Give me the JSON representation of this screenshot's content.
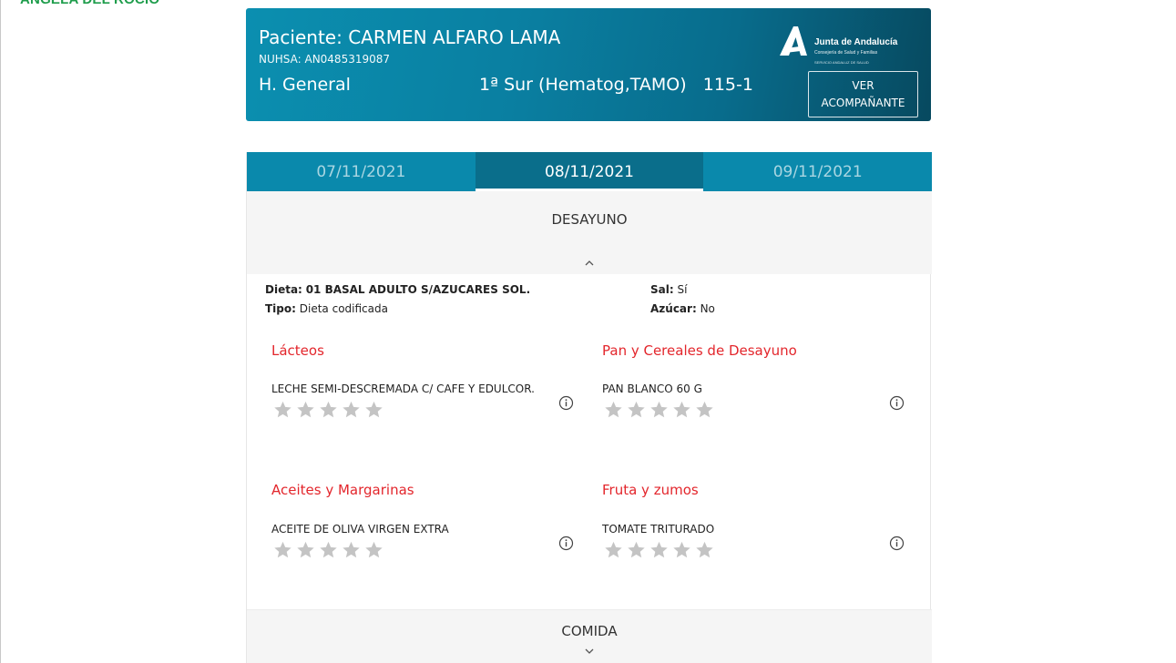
{
  "user": {
    "name": "ANGELA DEL ROCIO"
  },
  "header": {
    "patient_label": "Paciente: CARMEN ALFARO LAMA",
    "nuhsa": "NUHSA: AN0485319087",
    "hospital": "H. General",
    "ward": "1ª Sur (Hematog,TAMO)   115-1",
    "logo": {
      "title": "Junta de Andalucía",
      "subtitle": "Consejería de Salud y Familias",
      "subtitle2": "SERVICIO ANDALUZ DE SALUD"
    },
    "companion_button": {
      "line1": "VER",
      "line2": "ACOMPAÑANTE"
    }
  },
  "tabs": [
    {
      "label": "07/11/2021",
      "active": false
    },
    {
      "label": "08/11/2021",
      "active": true
    },
    {
      "label": "09/11/2021",
      "active": false
    }
  ],
  "meal": {
    "title": "DESAYUNO",
    "diet": {
      "dieta_label": "Dieta:",
      "dieta_value": "01 BASAL ADULTO S/AZUCARES SOL.",
      "tipo_label": "Tipo:",
      "tipo_value": "Dieta codificada",
      "sal_label": "Sal:",
      "sal_value": "Sí",
      "azucar_label": "Azúcar:",
      "azucar_value": "No"
    },
    "categories": [
      {
        "name": "Lácteos",
        "item": "LECHE SEMI-DESCREMADA C/ CAFE Y EDULCOR.",
        "rating": 0
      },
      {
        "name": "Pan y Cereales de Desayuno",
        "item": "PAN BLANCO 60 G",
        "rating": 0
      },
      {
        "name": "Aceites y Margarinas",
        "item": "ACEITE DE OLIVA VIRGEN EXTRA",
        "rating": 0
      },
      {
        "name": "Fruta y zumos",
        "item": "TOMATE TRITURADO",
        "rating": 0
      }
    ]
  },
  "next_meal": {
    "title": "COMIDA"
  },
  "colors": {
    "header_start": "#0b8fb0",
    "header_end": "#07495f",
    "tab_bar": "#0a89ac",
    "tab_active": "#0a6e8b",
    "category": "#e3262c",
    "star": "#c4c4c4",
    "user": "#1f9d4c"
  },
  "icons": {
    "star": "star-icon",
    "info": "info-icon",
    "chevron_up": "chevron-up-icon",
    "chevron_down": "chevron-down-icon",
    "logo": "junta-andalucia-logo"
  }
}
